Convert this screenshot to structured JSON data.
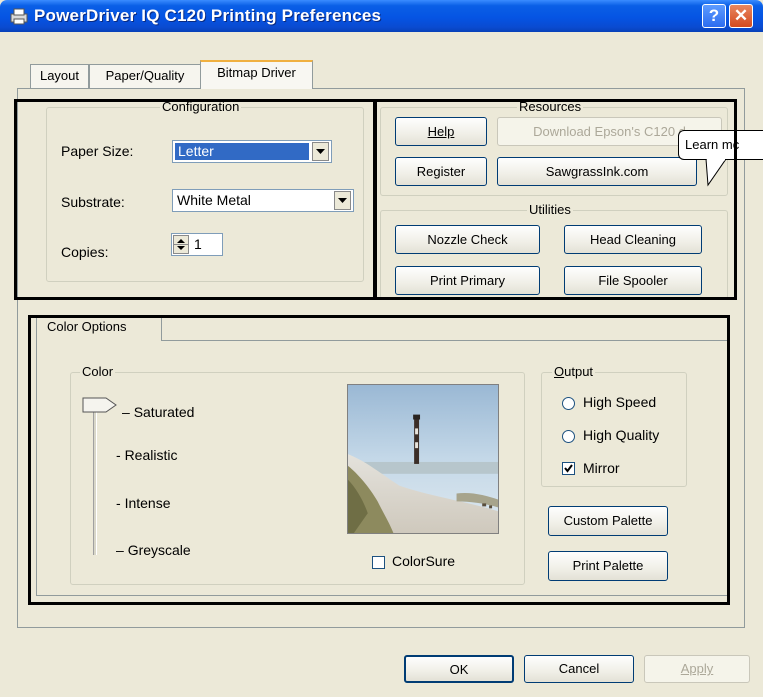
{
  "window": {
    "title": "PowerDriver IQ C120 Printing Preferences",
    "help_glyph": "?",
    "close_glyph": "✕"
  },
  "tabs": [
    "Layout",
    "Paper/Quality",
    "Bitmap Driver"
  ],
  "configuration": {
    "legend": "Configuration",
    "paper_size_label": "Paper Size:",
    "paper_size_value": "Letter",
    "substrate_label": "Substrate:",
    "substrate_value": "White Metal",
    "copies_label": "Copies:",
    "copies_value": "1"
  },
  "resources": {
    "legend": "Resources",
    "help": "Help",
    "download": "Download Epson's C120 d",
    "register": "Register",
    "sawgrass": "SawgrassInk.com",
    "tooltip": "Learn mc"
  },
  "utilities": {
    "legend": "Utilities",
    "nozzle_check": "Nozzle Check",
    "head_cleaning": "Head Cleaning",
    "print_primary": "Print Primary",
    "file_spooler": "File Spooler"
  },
  "color_options": {
    "tab": "Color Options",
    "color_legend": "Color",
    "levels": [
      "Saturated",
      "Realistic",
      "Intense",
      "Greyscale"
    ],
    "selected_level": "Saturated",
    "colorsure": "ColorSure",
    "colorsure_checked": false,
    "output_legend": "Output",
    "high_speed": "High Speed",
    "high_quality": "High Quality",
    "mirror": "Mirror",
    "mirror_checked": true,
    "custom_palette": "Custom Palette",
    "print_palette": "Print Palette"
  },
  "footer": {
    "ok": "OK",
    "cancel": "Cancel",
    "apply": "Apply"
  }
}
